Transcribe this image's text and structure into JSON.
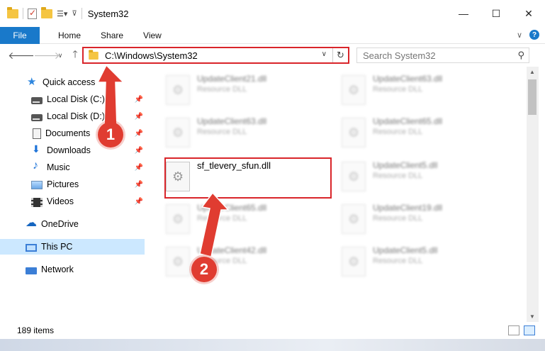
{
  "window": {
    "title": "System32",
    "minimize": "—",
    "maximize": "☐",
    "close": "✕"
  },
  "ribbon": {
    "file": "File",
    "tabs": [
      "Home",
      "Share",
      "View"
    ],
    "expand": "∨",
    "help": "?"
  },
  "address": {
    "path": "C:\\Windows\\System32",
    "search_placeholder": "Search System32"
  },
  "sidebar": {
    "items": [
      {
        "label": "Quick access",
        "icon": "star-icon"
      },
      {
        "label": "Local Disk (C:)",
        "icon": "drive-icon"
      },
      {
        "label": "Local Disk (D:)",
        "icon": "drive-icon"
      },
      {
        "label": "Documents",
        "icon": "documents-icon"
      },
      {
        "label": "Downloads",
        "icon": "download-icon"
      },
      {
        "label": "Music",
        "icon": "music-icon"
      },
      {
        "label": "Pictures",
        "icon": "pictures-icon"
      },
      {
        "label": "Videos",
        "icon": "videos-icon"
      },
      {
        "label": "OneDrive",
        "icon": "cloud-icon"
      },
      {
        "label": "This PC",
        "icon": "computer-icon"
      },
      {
        "label": "Network",
        "icon": "network-icon"
      }
    ]
  },
  "files": {
    "left": [
      {
        "name": "UpdateClient21.dll",
        "type": "Resource DLL"
      },
      {
        "name": "UpdateClient63.dll",
        "type": "Resource DLL"
      },
      {
        "name": "sf_tlevery_sfun.dll",
        "type": ""
      },
      {
        "name": "UpdateClient65.dll",
        "type": "Resource DLL"
      },
      {
        "name": "UpdateClient42.dll",
        "type": "Resource DLL"
      }
    ],
    "right": [
      {
        "name": "UpdateClient63.dll",
        "type": "Resource DLL"
      },
      {
        "name": "UpdateClient65.dll",
        "type": "Resource DLL"
      },
      {
        "name": "UpdateClient5.dll",
        "type": "Resource DLL"
      },
      {
        "name": "UpdateClient19.dll",
        "type": "Resource DLL"
      },
      {
        "name": "UpdateClient5.dll",
        "type": "Resource DLL"
      }
    ]
  },
  "status": {
    "count": "189 items"
  },
  "callouts": {
    "one": "1",
    "two": "2"
  },
  "colors": {
    "accent": "#1979ca",
    "highlight": "#d9252a",
    "callout": "#e03c31"
  }
}
